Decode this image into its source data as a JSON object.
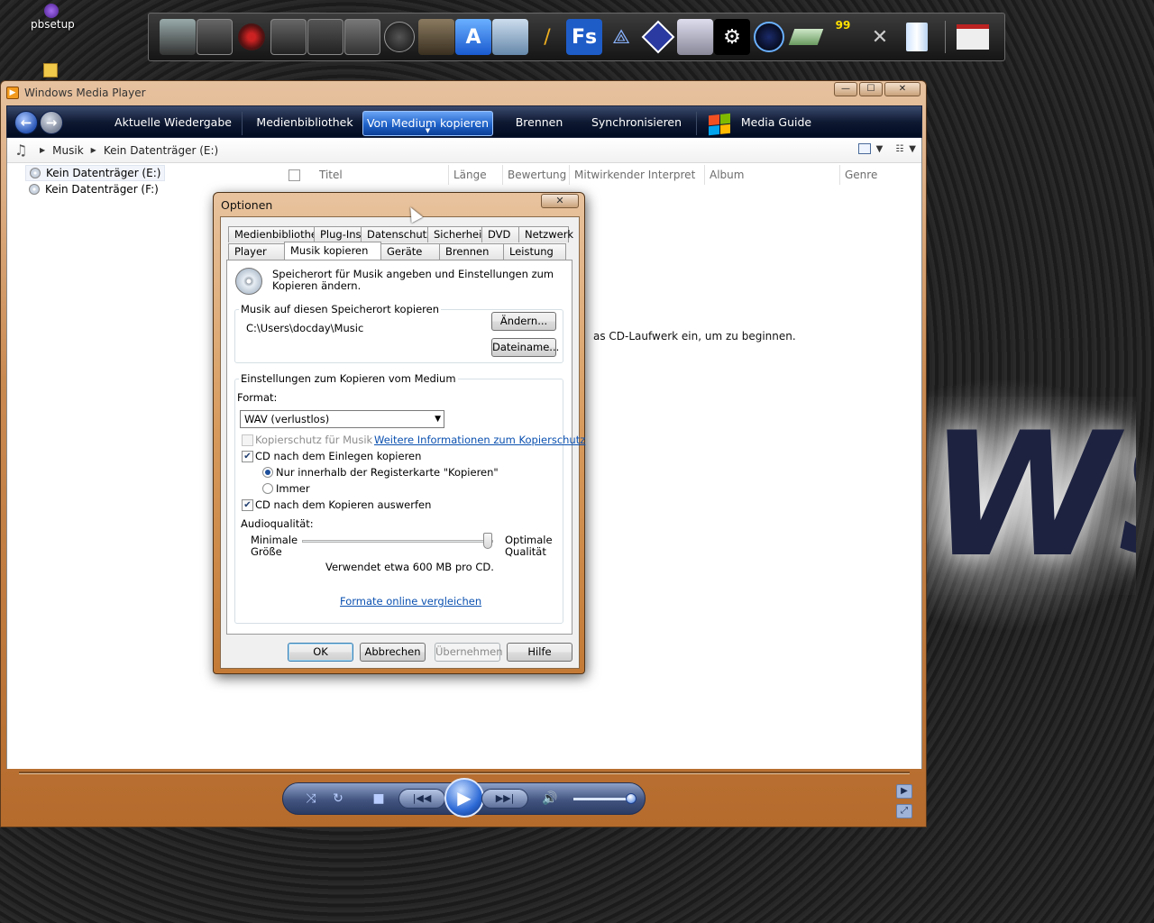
{
  "desktop": {
    "icons": [
      {
        "label": "pbsetup",
        "icon": "pbsetup-icon"
      },
      {
        "label": "",
        "icon": "folder-icon"
      }
    ],
    "dock_icons": [
      "monitor-icon",
      "tool-icon",
      "disc-icon",
      "tool-icon",
      "tool-icon",
      "tool-icon",
      "callofduty-icon",
      "callofduty2-icon",
      "arrow-app-icon",
      "window-app-icon",
      "brush-icon",
      "fs-icon",
      "network-icon",
      "info-diamond-icon",
      "computer-network-icon",
      "steam-icon",
      "gauge-icon",
      "drive-icon",
      "monitor-99-icon",
      "tools-icon",
      "recycle-bin-icon",
      "window-icon"
    ],
    "dock_fs_label": "Fs",
    "dock_badge": "99"
  },
  "wmp": {
    "title": "Windows Media Player",
    "nav": {
      "tabs": [
        "Aktuelle Wiedergabe",
        "Medienbibliothek",
        "Von Medium kopieren",
        "Brennen",
        "Synchronisieren",
        "Media Guide"
      ],
      "active_tab": "Von Medium kopieren"
    },
    "breadcrumb": [
      "Musik",
      "Kein Datenträger (E:)"
    ],
    "tree": [
      "Kein Datenträger (E:)",
      "Kein Datenträger (F:)"
    ],
    "columns": [
      "Titel",
      "Länge",
      "Bewertung",
      "Mitwirkender Interpret",
      "Album",
      "Genre"
    ],
    "hint": "as CD-Laufwerk ein, um zu beginnen."
  },
  "dialog": {
    "title": "Optionen",
    "tabs_row1": [
      "Medienbibliothek",
      "Plug-Ins",
      "Datenschutz",
      "Sicherheit",
      "DVD",
      "Netzwerk"
    ],
    "tabs_row2": [
      "Player",
      "Musik kopieren",
      "Geräte",
      "Brennen",
      "Leistung"
    ],
    "active_tab": "Musik kopieren",
    "intro": "Speicherort für Musik angeben und Einstellungen zum Kopieren ändern.",
    "location_group": "Musik auf diesen Speicherort kopieren",
    "path": "C:\\Users\\docday\\Music",
    "change_btn": "Ändern...",
    "filename_btn": "Dateiname...",
    "settings_group": "Einstellungen zum Kopieren vom Medium",
    "format_label": "Format:",
    "format_value": "WAV (verlustlos)",
    "copy_protect": {
      "label": "Kopierschutz für Musik",
      "checked": false,
      "enabled": false
    },
    "copy_protect_link": "Weitere Informationen zum Kopierschutz",
    "rip_on_insert": {
      "label": "CD nach dem Einlegen kopieren",
      "checked": true
    },
    "radio_tab_only": {
      "label": "Nur innerhalb der Registerkarte \"Kopieren\"",
      "selected": true
    },
    "radio_always": {
      "label": "Immer",
      "selected": false
    },
    "eject_after": {
      "label": "CD nach dem Kopieren auswerfen",
      "checked": true
    },
    "quality_label": "Audioqualität:",
    "quality_min": "Minimale\nGröße",
    "quality_min_1": "Minimale",
    "quality_min_2": "Größe",
    "quality_max_1": "Optimale",
    "quality_max_2": "Qualität",
    "quality_level": 1.0,
    "usage_text": "Verwendet etwa 600 MB pro CD.",
    "compare_link": "Formate online vergleichen",
    "ok": "OK",
    "cancel": "Abbrechen",
    "apply": "Übernehmen",
    "help": "Hilfe"
  },
  "colors": {
    "accent": "#1f62c9",
    "frame": "#c98a52"
  }
}
